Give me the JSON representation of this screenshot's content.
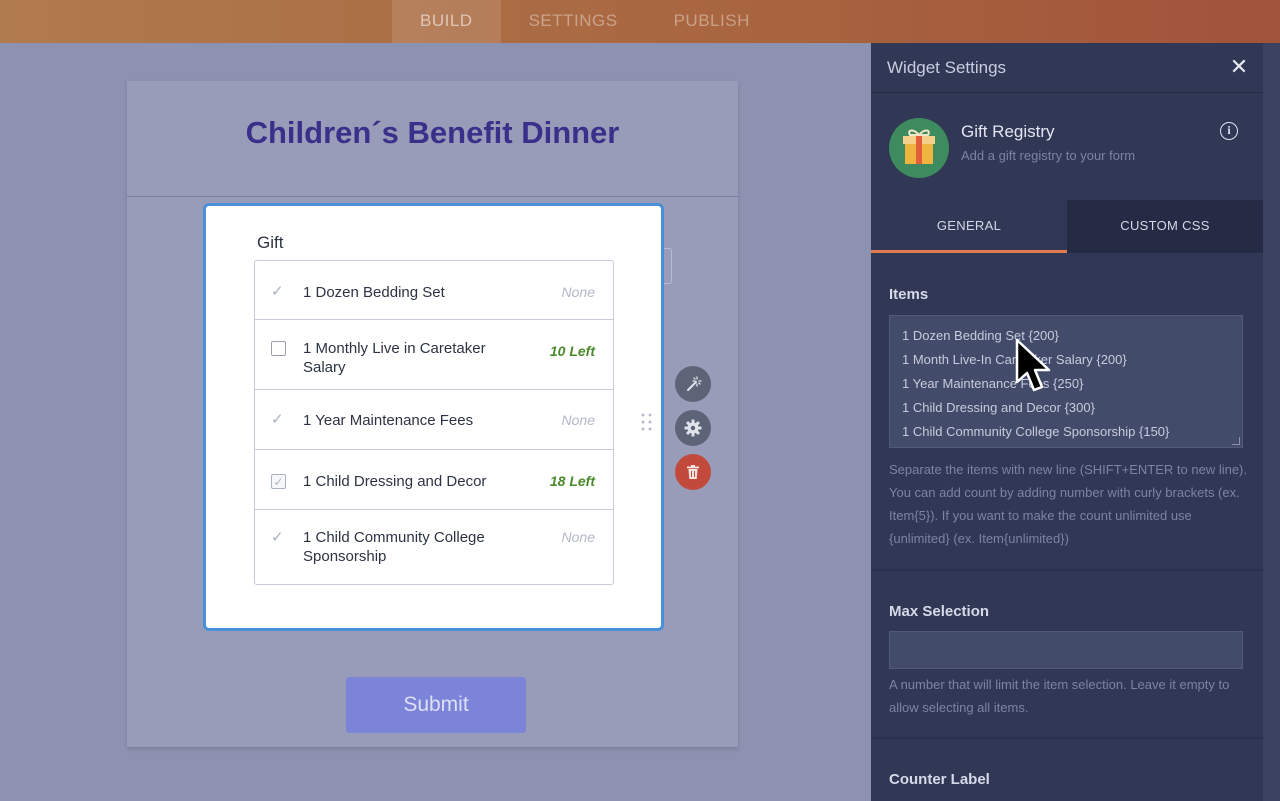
{
  "topbar": {
    "tabs": [
      {
        "label": "BUILD",
        "active": true
      },
      {
        "label": "SETTINGS",
        "active": false
      },
      {
        "label": "PUBLISH",
        "active": false
      }
    ]
  },
  "form": {
    "title": "Children´s Benefit Dinner",
    "submit_label": "Submit",
    "widget": {
      "label": "Gift",
      "items": [
        {
          "name": "1 Dozen Bedding Set",
          "mark": "check",
          "count": "None",
          "count_type": "none"
        },
        {
          "name": "1 Monthly Live in Caretaker Salary",
          "mark": "checkbox",
          "count": "10 Left",
          "count_type": "left"
        },
        {
          "name": "1 Year Maintenance Fees",
          "mark": "check",
          "count": "None",
          "count_type": "none"
        },
        {
          "name": "1 Child Dressing and Decor",
          "mark": "checkbox-checked",
          "count": "18 Left",
          "count_type": "left"
        },
        {
          "name": "1 Child Community College Sponsorship",
          "mark": "check",
          "count": "None",
          "count_type": "none"
        }
      ]
    }
  },
  "panel": {
    "title": "Widget Settings",
    "widget_name": "Gift Registry",
    "widget_desc": "Add a gift registry to your form",
    "tabs": [
      {
        "label": "GENERAL",
        "active": true
      },
      {
        "label": "CUSTOM CSS",
        "active": false
      }
    ],
    "items_label": "Items",
    "items_lines": [
      "1 Dozen Bedding Set {200}",
      "1 Month Live-In Caretaker Salary {200}",
      "1 Year Maintenance Fees {250}",
      "1 Child Dressing and Decor {300}",
      "1 Child Community College Sponsorship {150}"
    ],
    "items_help": "Separate the items with new line (SHIFT+ENTER to new line). You can add count by adding number with curly brackets (ex. Item{5}). If you want to make the count unlimited use {unlimited} (ex. Item{unlimited})",
    "max_label": "Max Selection",
    "max_value": "",
    "max_help": "A number that will limit the item selection. Leave it empty to allow selecting all items.",
    "counter_label": "Counter Label"
  },
  "colors": {
    "accent": "#e07b52",
    "title": "#3a2f8a",
    "left_count": "#4a8a2c",
    "delete": "#c24a3d"
  },
  "icons": [
    "check-icon",
    "close-icon",
    "info-icon",
    "gift-icon",
    "wand-icon",
    "gear-icon",
    "trash-icon",
    "drag-handle-icon",
    "cursor-icon"
  ]
}
